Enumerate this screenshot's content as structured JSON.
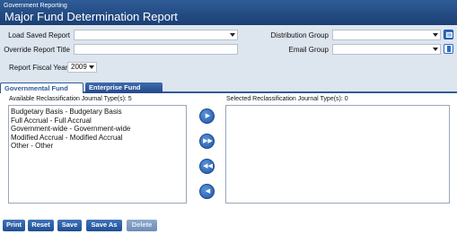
{
  "header": {
    "breadcrumb": "Government Reporting",
    "title": "Major Fund Determination Report"
  },
  "form": {
    "load_saved_label": "Load Saved Report",
    "load_saved_value": "",
    "override_title_label": "Override Report Title",
    "override_title_value": "",
    "distribution_group_label": "Distribution Group",
    "distribution_group_value": "",
    "email_group_label": "Email Group",
    "email_group_value": "",
    "fiscal_year_label": "Report Fiscal Year",
    "fiscal_year_value": "2009"
  },
  "tabs": [
    {
      "label": "Governmental Fund Types",
      "active": true
    },
    {
      "label": "Enterprise Fund Types",
      "active": false
    }
  ],
  "available": {
    "title": "Available Reclassification Journal Type(s): 5",
    "items": [
      "Budgetary Basis - Budgetary Basis",
      "Full Accrual - Full Accrual",
      "Government-wide - Government-wide",
      "Modified Accrual - Modified Accrual",
      "Other - Other"
    ]
  },
  "selected": {
    "title": "Selected Reclassification Journal Type(s): 0",
    "items": []
  },
  "buttons": {
    "print": "Print",
    "reset": "Reset",
    "save": "Save",
    "save_as": "Save As",
    "delete": "Delete"
  },
  "icons": {
    "move_right": "chevron-right-icon",
    "move_all_right": "double-chevron-right-icon",
    "move_all_left": "double-chevron-left-icon",
    "move_left": "chevron-left-icon"
  },
  "colors": {
    "header": "#1b3f73",
    "accent": "#2f5c97",
    "background": "#dde5ef"
  }
}
